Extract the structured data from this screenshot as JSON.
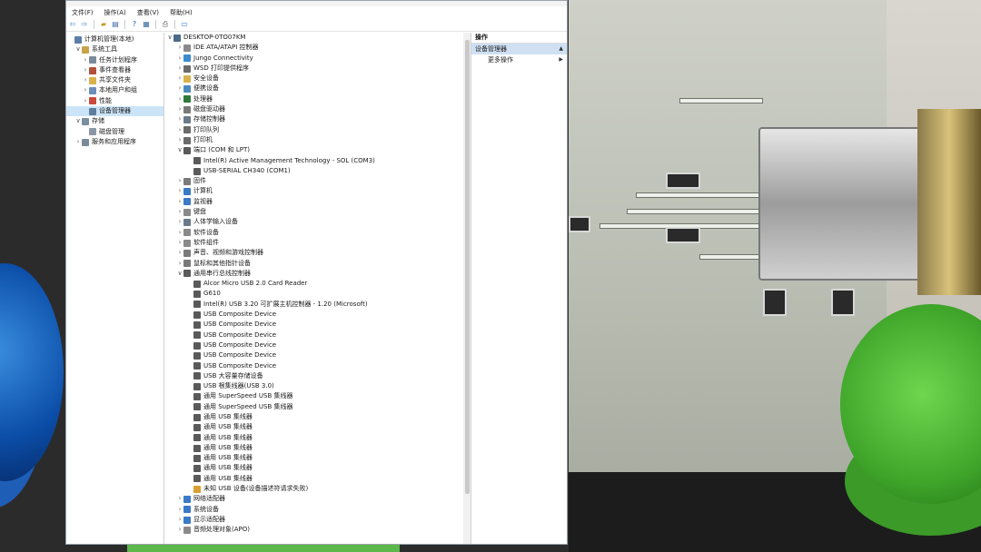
{
  "menu": [
    "文件(F)",
    "操作(A)",
    "查看(V)",
    "帮助(H)"
  ],
  "toolbar_icons": [
    "back-icon",
    "forward-icon",
    "folder-icon",
    "list-icon",
    "help-icon",
    "properties-icon",
    "print-icon",
    "monitor-icon"
  ],
  "left_tree": [
    {
      "label": "计算机管理(本地)",
      "level": 0,
      "chev": "",
      "icon": "#5a7fa8"
    },
    {
      "label": "系统工具",
      "level": 1,
      "chev": "∨",
      "icon": "#c9a34a"
    },
    {
      "label": "任务计划程序",
      "level": 2,
      "chev": "›",
      "icon": "#7b8a9a"
    },
    {
      "label": "事件查看器",
      "level": 2,
      "chev": "›",
      "icon": "#b0503a"
    },
    {
      "label": "共享文件夹",
      "level": 2,
      "chev": "›",
      "icon": "#d9b24a"
    },
    {
      "label": "本地用户和组",
      "level": 2,
      "chev": "›",
      "icon": "#6b8fb8"
    },
    {
      "label": "性能",
      "level": 2,
      "chev": "›",
      "icon": "#c94a3a"
    },
    {
      "label": "设备管理器",
      "level": 2,
      "chev": "",
      "icon": "#5d7e9c",
      "selected": true
    },
    {
      "label": "存储",
      "level": 1,
      "chev": "∨",
      "icon": "#7a8fa0"
    },
    {
      "label": "磁盘管理",
      "level": 2,
      "chev": "",
      "icon": "#8a98a6"
    },
    {
      "label": "服务和应用程序",
      "level": 1,
      "chev": "›",
      "icon": "#7a8a9a"
    }
  ],
  "device_tree": [
    {
      "label": "DESKTOP-0TO07KM",
      "level": 0,
      "chev": "∨",
      "icon": "#4b6a8a"
    },
    {
      "label": "IDE ATA/ATAPI 控制器",
      "level": 1,
      "chev": "›",
      "icon": "#8a8a8a"
    },
    {
      "label": "Jungo Connectivity",
      "level": 1,
      "chev": "›",
      "icon": "#3a8ad0"
    },
    {
      "label": "WSD 打印提供程序",
      "level": 1,
      "chev": "›",
      "icon": "#6a6a6a"
    },
    {
      "label": "安全设备",
      "level": 1,
      "chev": "›",
      "icon": "#d9b24a"
    },
    {
      "label": "便携设备",
      "level": 1,
      "chev": "›",
      "icon": "#4a8ac0"
    },
    {
      "label": "处理器",
      "level": 1,
      "chev": "›",
      "icon": "#2f7a3a"
    },
    {
      "label": "磁盘驱动器",
      "level": 1,
      "chev": "›",
      "icon": "#7a7a7a"
    },
    {
      "label": "存储控制器",
      "level": 1,
      "chev": "›",
      "icon": "#6a7a8a"
    },
    {
      "label": "打印队列",
      "level": 1,
      "chev": "›",
      "icon": "#6a6a6a"
    },
    {
      "label": "打印机",
      "level": 1,
      "chev": "›",
      "icon": "#6a6a6a"
    },
    {
      "label": "端口 (COM 和 LPT)",
      "level": 1,
      "chev": "∨",
      "icon": "#5a5a5a"
    },
    {
      "label": "Intel(R) Active Management Technology - SOL (COM3)",
      "level": 2,
      "chev": "",
      "icon": "#5a5a5a"
    },
    {
      "label": "USB-SERIAL CH340 (COM1)",
      "level": 2,
      "chev": "",
      "icon": "#5a5a5a"
    },
    {
      "label": "固件",
      "level": 1,
      "chev": "›",
      "icon": "#7a7a7a"
    },
    {
      "label": "计算机",
      "level": 1,
      "chev": "›",
      "icon": "#3a7ac8"
    },
    {
      "label": "监视器",
      "level": 1,
      "chev": "›",
      "icon": "#3a7ac8"
    },
    {
      "label": "键盘",
      "level": 1,
      "chev": "›",
      "icon": "#8a8a8a"
    },
    {
      "label": "人体学输入设备",
      "level": 1,
      "chev": "›",
      "icon": "#6a7a8a"
    },
    {
      "label": "软件设备",
      "level": 1,
      "chev": "›",
      "icon": "#8a8a8a"
    },
    {
      "label": "软件组件",
      "level": 1,
      "chev": "›",
      "icon": "#8a8a8a"
    },
    {
      "label": "声音、视频和游戏控制器",
      "level": 1,
      "chev": "›",
      "icon": "#7a7a7a"
    },
    {
      "label": "鼠标和其他指针设备",
      "level": 1,
      "chev": "›",
      "icon": "#7a7a7a"
    },
    {
      "label": "通用串行总线控制器",
      "level": 1,
      "chev": "∨",
      "icon": "#5a5a5a"
    },
    {
      "label": "Alcor Micro USB 2.0 Card Reader",
      "level": 2,
      "chev": "",
      "icon": "#5a5a5a"
    },
    {
      "label": "G610",
      "level": 2,
      "chev": "",
      "icon": "#5a5a5a"
    },
    {
      "label": "Intel(R) USB 3.20 可扩展主机控制器 - 1.20 (Microsoft)",
      "level": 2,
      "chev": "",
      "icon": "#5a5a5a"
    },
    {
      "label": "USB Composite Device",
      "level": 2,
      "chev": "",
      "icon": "#5a5a5a"
    },
    {
      "label": "USB Composite Device",
      "level": 2,
      "chev": "",
      "icon": "#5a5a5a"
    },
    {
      "label": "USB Composite Device",
      "level": 2,
      "chev": "",
      "icon": "#5a5a5a"
    },
    {
      "label": "USB Composite Device",
      "level": 2,
      "chev": "",
      "icon": "#5a5a5a"
    },
    {
      "label": "USB Composite Device",
      "level": 2,
      "chev": "",
      "icon": "#5a5a5a"
    },
    {
      "label": "USB Composite Device",
      "level": 2,
      "chev": "",
      "icon": "#5a5a5a"
    },
    {
      "label": "USB 大容量存储设备",
      "level": 2,
      "chev": "",
      "icon": "#5a5a5a"
    },
    {
      "label": "USB 根集线器(USB 3.0)",
      "level": 2,
      "chev": "",
      "icon": "#5a5a5a"
    },
    {
      "label": "通用 SuperSpeed USB 集线器",
      "level": 2,
      "chev": "",
      "icon": "#5a5a5a"
    },
    {
      "label": "通用 SuperSpeed USB 集线器",
      "level": 2,
      "chev": "",
      "icon": "#5a5a5a"
    },
    {
      "label": "通用 USB 集线器",
      "level": 2,
      "chev": "",
      "icon": "#5a5a5a"
    },
    {
      "label": "通用 USB 集线器",
      "level": 2,
      "chev": "",
      "icon": "#5a5a5a"
    },
    {
      "label": "通用 USB 集线器",
      "level": 2,
      "chev": "",
      "icon": "#5a5a5a"
    },
    {
      "label": "通用 USB 集线器",
      "level": 2,
      "chev": "",
      "icon": "#5a5a5a"
    },
    {
      "label": "通用 USB 集线器",
      "level": 2,
      "chev": "",
      "icon": "#5a5a5a"
    },
    {
      "label": "通用 USB 集线器",
      "level": 2,
      "chev": "",
      "icon": "#5a5a5a"
    },
    {
      "label": "通用 USB 集线器",
      "level": 2,
      "chev": "",
      "icon": "#5a5a5a"
    },
    {
      "label": "未知 USB 设备(设备描述符请求失败)",
      "level": 2,
      "chev": "",
      "icon": "#d9a030",
      "warning": true
    },
    {
      "label": "网络适配器",
      "level": 1,
      "chev": "›",
      "icon": "#3a7ac8"
    },
    {
      "label": "系统设备",
      "level": 1,
      "chev": "›",
      "icon": "#3a7ac8"
    },
    {
      "label": "显示适配器",
      "level": 1,
      "chev": "›",
      "icon": "#3a7ac8"
    },
    {
      "label": "音频处理对象(APO)",
      "level": 1,
      "chev": "›",
      "icon": "#8a8a8a"
    }
  ],
  "actions": {
    "title": "操作",
    "selected": "设备管理器",
    "more": "更多操作"
  }
}
